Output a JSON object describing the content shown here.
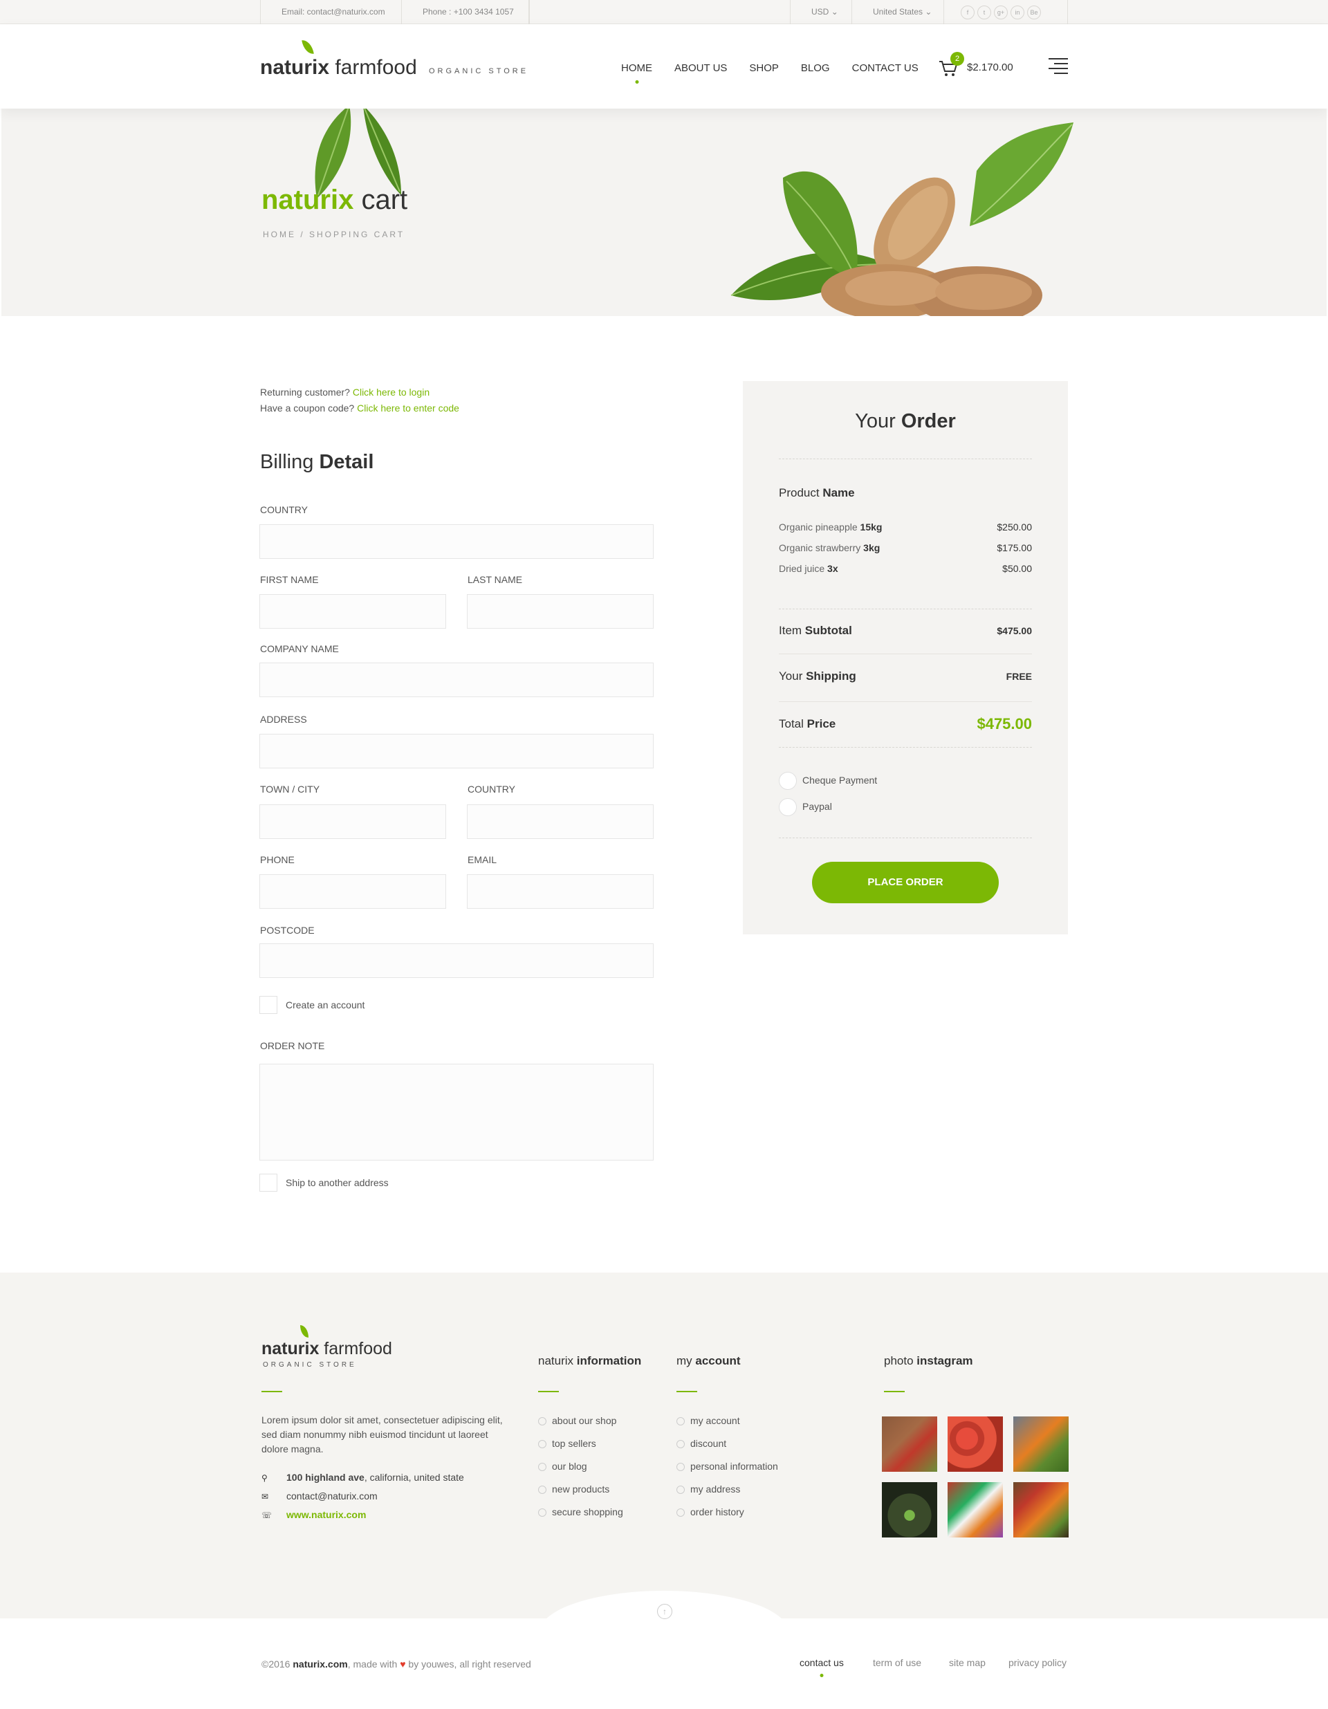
{
  "topbar": {
    "email": "Email: contact@naturix.com",
    "phone": "Phone : +100 3434 1057",
    "currency": "USD",
    "country": "United States",
    "social": [
      "f",
      "t",
      "g+",
      "in",
      "Be"
    ]
  },
  "header": {
    "brand_bold": "naturix",
    "brand_light": " farmfood",
    "tagline": "ORGANIC STORE",
    "nav": [
      "HOME",
      "ABOUT US",
      "SHOP",
      "BLOG",
      "CONTACT US"
    ],
    "cart_count": "2",
    "cart_total": "$2.170.00"
  },
  "hero": {
    "title_bold": "naturix",
    "title_light": " cart",
    "breadcrumb": "HOME / SHOPPING CART"
  },
  "checkout": {
    "returning_text": "Returning customer? ",
    "returning_link": "Click here to login",
    "coupon_text": "Have a coupon code? ",
    "coupon_link": "Click here to enter code",
    "billing_light": "Billing ",
    "billing_bold": "Detail",
    "labels": {
      "country": "COUNTRY",
      "first_name": "FIRST NAME",
      "last_name": "LAST NAME",
      "company": "COMPANY NAME",
      "address": "ADDRESS",
      "town": "TOWN / CITY",
      "country2": "COUNTRY",
      "phone": "PHONE",
      "email": "EMAIL",
      "postcode": "POSTCODE",
      "order_note": "ORDER NOTE"
    },
    "create_account": "Create an account",
    "ship_other": "Ship to another address"
  },
  "order": {
    "title_light": "Your ",
    "title_bold": "Order",
    "product_light": "Product ",
    "product_bold": "Name",
    "items": [
      {
        "name": "Organic pineapple ",
        "qty": "15kg",
        "price": "$250.00"
      },
      {
        "name": "Organic strawberry ",
        "qty": "3kg",
        "price": "$175.00"
      },
      {
        "name": "Dried juice ",
        "qty": "3x",
        "price": "$50.00"
      }
    ],
    "subtotal_light": "Item ",
    "subtotal_bold": "Subtotal",
    "subtotal_value": "$475.00",
    "shipping_light": "Your ",
    "shipping_bold": "Shipping",
    "shipping_value": "FREE",
    "total_light": "Total ",
    "total_bold": "Price",
    "total_value": "$475.00",
    "payments": [
      "Cheque Payment",
      "Paypal"
    ],
    "place_order": "PLACE ORDER"
  },
  "footer": {
    "brand_bold": "naturix",
    "brand_light": " farmfood",
    "tagline": "ORGANIC STORE",
    "description": "Lorem ipsum dolor sit amet, consectetuer adipiscing elit, sed diam nonummy nibh euismod tincidunt ut laoreet dolore magna.",
    "address_bold": "100 highland ave",
    "address_rest": ", california, united state",
    "email": "contact@naturix.com",
    "website": "www.naturix.com",
    "info_light": "naturix ",
    "info_bold": "information",
    "info_links": [
      "about our shop",
      "top sellers",
      "our blog",
      "new products",
      "secure shopping"
    ],
    "account_light": "my ",
    "account_bold": "account",
    "account_links": [
      "my account",
      "discount",
      "personal information",
      "my address",
      "order history"
    ],
    "insta_light": "photo ",
    "insta_bold": "instagram",
    "copyright_pre": "©2016 ",
    "copyright_brand": "naturix.com",
    "copyright_mid": ", made with ",
    "copyright_post": " by youwes, all right reserved",
    "bottom_links": [
      "contact us",
      "term of use",
      "site map",
      "privacy policy"
    ]
  }
}
